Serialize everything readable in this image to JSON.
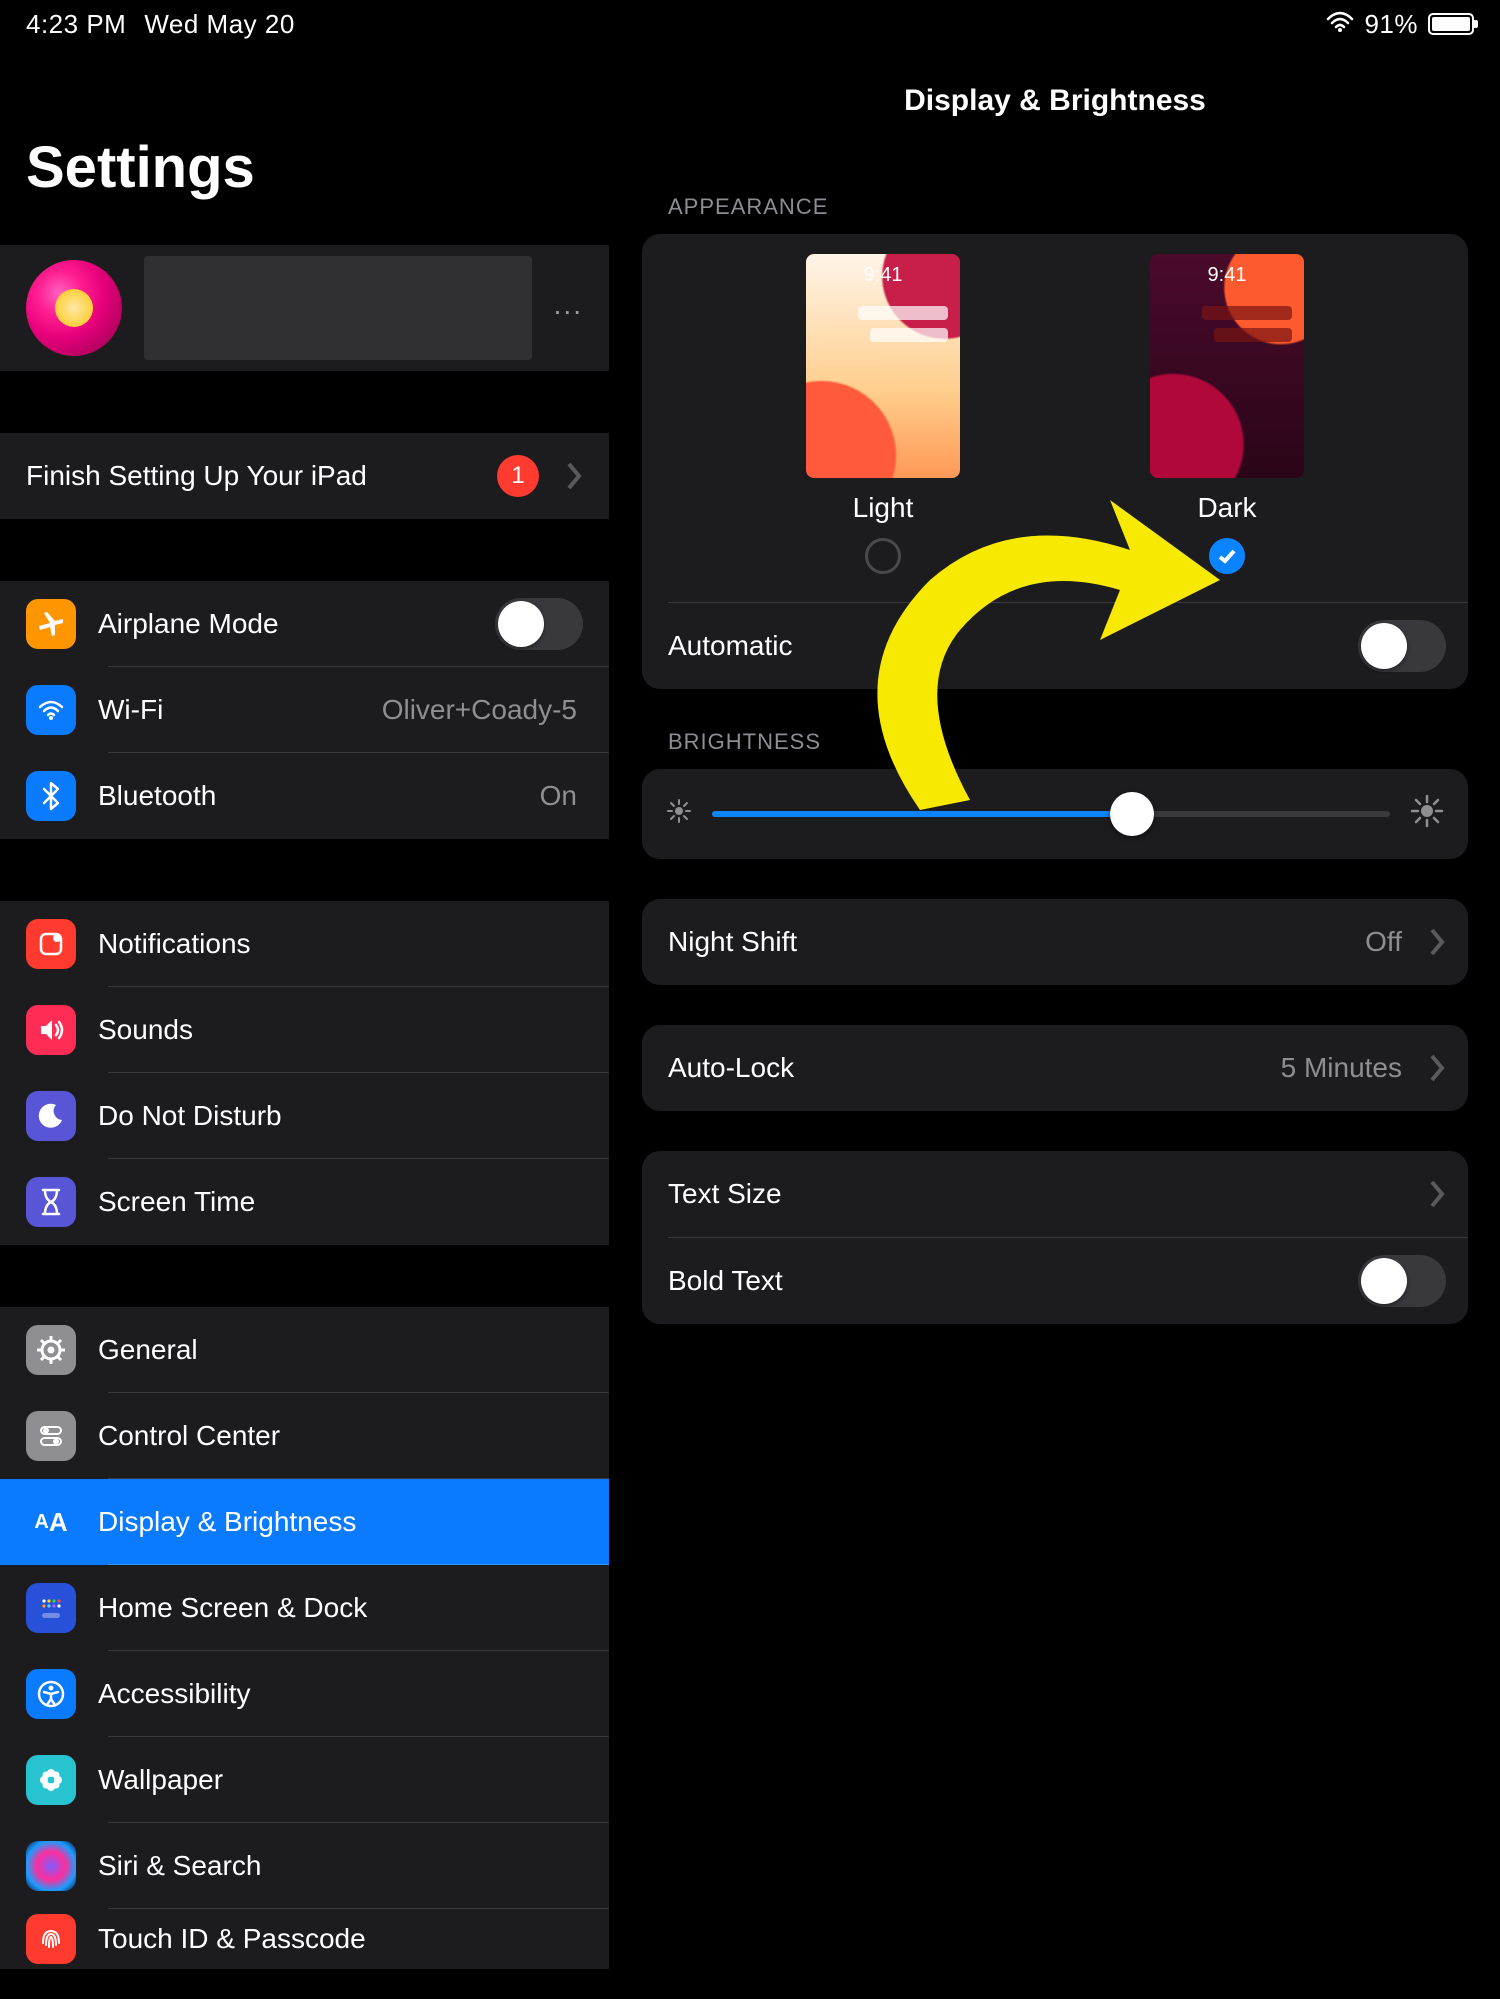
{
  "status": {
    "time": "4:23 PM",
    "date": "Wed May 20",
    "battery_pct": "91%"
  },
  "sidebar": {
    "title": "Settings",
    "finish_setup": {
      "label": "Finish Setting Up Your iPad",
      "badge": "1"
    },
    "airplane": {
      "label": "Airplane Mode",
      "on": false
    },
    "wifi": {
      "label": "Wi-Fi",
      "value": "Oliver+Coady-5"
    },
    "bluetooth": {
      "label": "Bluetooth",
      "value": "On"
    },
    "notifications": {
      "label": "Notifications"
    },
    "sounds": {
      "label": "Sounds"
    },
    "dnd": {
      "label": "Do Not Disturb"
    },
    "screentime": {
      "label": "Screen Time"
    },
    "general": {
      "label": "General"
    },
    "cc": {
      "label": "Control Center"
    },
    "display": {
      "label": "Display & Brightness"
    },
    "home": {
      "label": "Home Screen & Dock"
    },
    "accessibility": {
      "label": "Accessibility"
    },
    "wallpaper": {
      "label": "Wallpaper"
    },
    "siri": {
      "label": "Siri & Search"
    },
    "touchid": {
      "label": "Touch ID & Passcode"
    }
  },
  "content": {
    "title": "Display & Brightness",
    "appearance_header": "APPEARANCE",
    "light": {
      "label": "Light",
      "time": "9:41",
      "selected": false
    },
    "dark": {
      "label": "Dark",
      "time": "9:41",
      "selected": true
    },
    "automatic": {
      "label": "Automatic",
      "on": false
    },
    "brightness_header": "BRIGHTNESS",
    "brightness_pct": 62,
    "night_shift": {
      "label": "Night Shift",
      "value": "Off"
    },
    "auto_lock": {
      "label": "Auto-Lock",
      "value": "5 Minutes"
    },
    "text_size": {
      "label": "Text Size"
    },
    "bold_text": {
      "label": "Bold Text",
      "on": false
    }
  }
}
